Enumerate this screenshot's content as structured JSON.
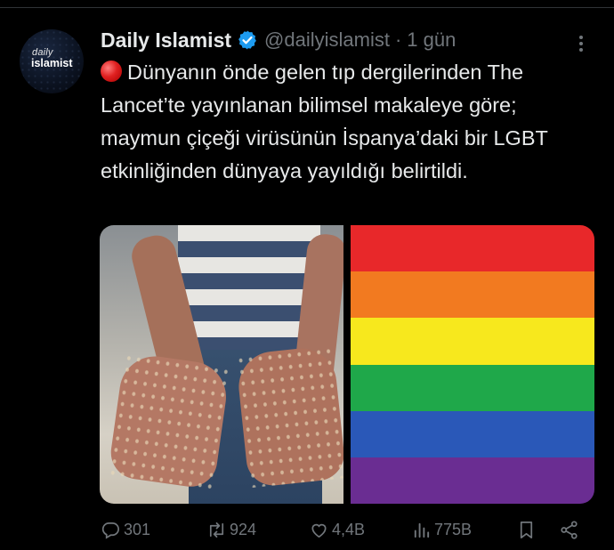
{
  "tweet": {
    "author": {
      "name": "Daily Islamist",
      "handle": "@dailyislamist",
      "verified": true,
      "avatar_text_line1": "daily",
      "avatar_text_line2": "islamist"
    },
    "separator": "·",
    "time": "1 gün",
    "text": "Dünyanın önde gelen tıp dergilerinden The Lancet’te yayınlanan bilimsel makaleye göre; maymun çiçeği virüsünün İspanya’daki bir LGBT etkinliğinden dünyaya yayıldığı belirtildi.",
    "leading_emoji": "red-circle-icon",
    "media": {
      "images": [
        {
          "name": "hands-with-lesions-photo"
        },
        {
          "name": "rainbow-flag-photo",
          "stripe_colors": [
            "#e8282a",
            "#f27a20",
            "#f7e81d",
            "#1fa84a",
            "#2a58b8",
            "#6a2d92"
          ]
        }
      ]
    },
    "actions": {
      "replies": "301",
      "retweets": "924",
      "likes": "4,4B",
      "views": "775B"
    }
  },
  "colors": {
    "background": "#000000",
    "text": "#e7e9ea",
    "secondary": "#71767b",
    "verified": "#1d9bf0"
  }
}
